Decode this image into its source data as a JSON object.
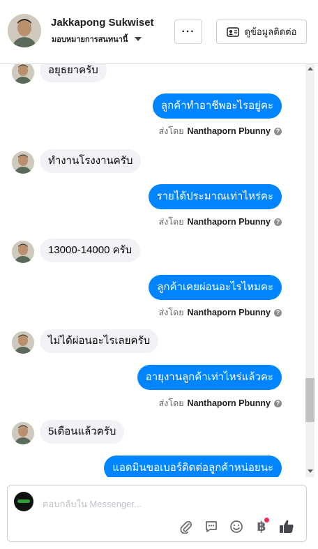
{
  "header": {
    "name": "Jakkapong Sukwiset",
    "subtitle": "มอบหมายการสนทนานี้",
    "more_label": "···",
    "info_label": "ดูข้อมูลติดต่อ"
  },
  "messages": [
    {
      "type": "in",
      "text": "อยุธยาครับ"
    },
    {
      "type": "out",
      "text": "ลูกค้าทำอาชีพอะไรอยู่คะ",
      "sent_by_prefix": "ส่งโดย",
      "sent_by": "Nanthaporn Pbunny"
    },
    {
      "type": "in",
      "text": "ทำงานโรงงานครับ"
    },
    {
      "type": "out",
      "text": "รายได้ประมาณเท่าไหร่คะ",
      "sent_by_prefix": "ส่งโดย",
      "sent_by": "Nanthaporn Pbunny"
    },
    {
      "type": "in",
      "text": "13000-14000 ครับ"
    },
    {
      "type": "out",
      "text": "ลูกค้าเคยผ่อนอะไรไหมคะ",
      "sent_by_prefix": "ส่งโดย",
      "sent_by": "Nanthaporn Pbunny"
    },
    {
      "type": "in",
      "text": "ไม่ได้ผ่อนอะไรเลยครับ"
    },
    {
      "type": "out",
      "text": "อายุงานลูกค้าเท่าไหร่แล้วคะ",
      "sent_by_prefix": "ส่งโดย",
      "sent_by": "Nanthaporn Pbunny"
    },
    {
      "type": "in",
      "text": "5เดือนแล้วครับ"
    },
    {
      "type": "out",
      "text": "แอดมินขอเบอร์ติดต่อลูกค้าหน่อยนะ"
    }
  ],
  "composer": {
    "placeholder": "ตอบกลับใน Messenger...",
    "tools": [
      "attach-icon",
      "saved-reply-icon",
      "emoji-icon",
      "payment-icon",
      "like-icon"
    ],
    "payment_glyph": "฿"
  },
  "colors": {
    "outgoing_bubble": "#0084ff",
    "incoming_bubble": "#f0f2f5",
    "badge": "#f02849"
  }
}
